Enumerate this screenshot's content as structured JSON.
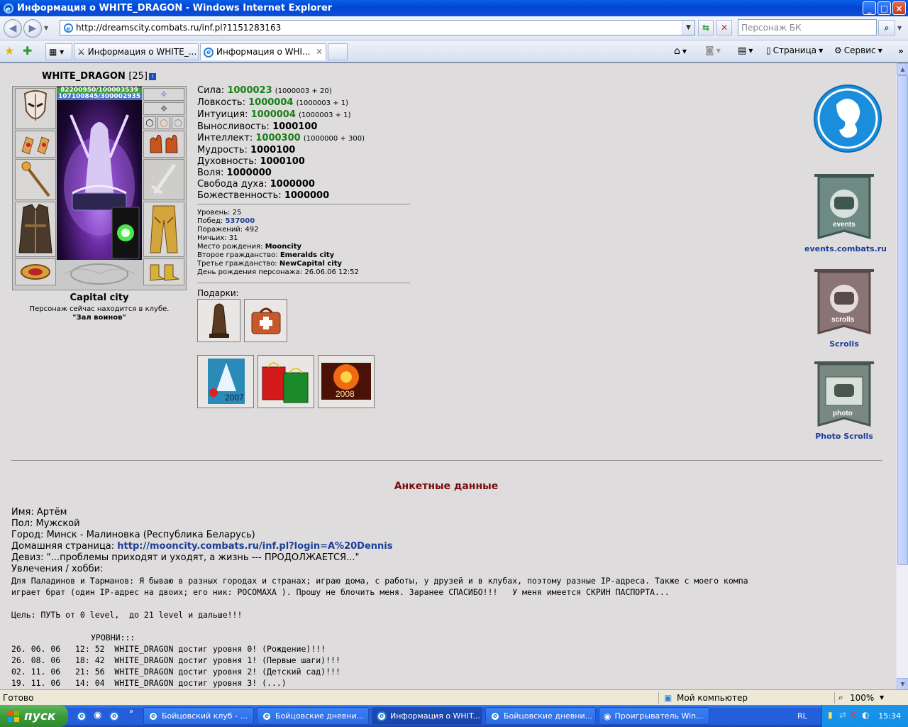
{
  "window": {
    "title": "Информация о WHITE_DRAGON - Windows Internet Explorer",
    "minimize": "_",
    "maximize": "□",
    "close": "×"
  },
  "address": {
    "url": "http://dreamscity.combats.ru/inf.pl?1151283163",
    "search_placeholder": "Персонаж БК"
  },
  "tabs": [
    {
      "label": "Информация о WHITE_..."
    },
    {
      "label": "Информация о WHI..."
    }
  ],
  "commands": {
    "page": "Страница",
    "service": "Сервис"
  },
  "character": {
    "name": "WHITE_DRAGON",
    "level": "[25]",
    "hp": "82200950/100003539",
    "mana": "107100845/300002935",
    "city": "Capital city",
    "location_line": "Персонаж сейчас находится в клубе.",
    "location_room": "\"Зал воинов\""
  },
  "stats": [
    {
      "label": "Сила:",
      "value": "1000023",
      "extra": "(1000003 + 20)",
      "color": "green"
    },
    {
      "label": "Ловкость:",
      "value": "1000004",
      "extra": "(1000003 + 1)",
      "color": "green"
    },
    {
      "label": "Интуиция:",
      "value": "1000004",
      "extra": "(1000003 + 1)",
      "color": "green"
    },
    {
      "label": "Выносливость:",
      "value": "1000100",
      "extra": "",
      "color": "black"
    },
    {
      "label": "Интеллект:",
      "value": "1000300",
      "extra": "(1000000 + 300)",
      "color": "green"
    },
    {
      "label": "Мудрость:",
      "value": "1000100",
      "extra": "",
      "color": "black"
    },
    {
      "label": "Духовность:",
      "value": "1000100",
      "extra": "",
      "color": "black"
    },
    {
      "label": "Воля:",
      "value": "1000000",
      "extra": "",
      "color": "black"
    },
    {
      "label": "Свобода духа:",
      "value": "1000000",
      "extra": "",
      "color": "black"
    },
    {
      "label": "Божественность:",
      "value": "1000000",
      "extra": "",
      "color": "black"
    }
  ],
  "info": [
    {
      "label": "Уровень:",
      "value": "25",
      "style": "plain"
    },
    {
      "label": "Побед:",
      "value": "537000",
      "style": "blue"
    },
    {
      "label": "Поражений:",
      "value": "492",
      "style": "plain"
    },
    {
      "label": "Ничьих:",
      "value": "31",
      "style": "plain"
    },
    {
      "label": "Место рождения:",
      "value": "Mooncity",
      "style": "bold"
    },
    {
      "label": "Второе гражданство:",
      "value": "Emeralds city",
      "style": "bold"
    },
    {
      "label": "Третье гражданство:",
      "value": "NewCapital city",
      "style": "bold"
    },
    {
      "label": "День рождения персонажа:",
      "value": "26.06.06 12:52",
      "style": "plain"
    }
  ],
  "gifts_label": "Подарки:",
  "sidebar": {
    "events_label": "events.combats.ru",
    "events_badge": "events",
    "scrolls_label": "Scrolls",
    "scrolls_badge": "scrolls",
    "photo_label": "Photo Scrolls",
    "photo_badge": "photo"
  },
  "gift_texts": {
    "year1": "2007",
    "year2": "2008"
  },
  "profile": {
    "heading": "Анкетные данные",
    "name": "Имя: Артём",
    "gender": "Пол: Мужской",
    "city": "Город: Минск - Малиновка (Республика Беларусь)",
    "homepage_label": "Домашняя страница:",
    "homepage_url": "http://mooncity.combats.ru/inf.pl?login=A%20Dennis",
    "motto": "Девиз: \"...проблемы приходят и уходят, а жизнь --- ПРОДОЛЖАЕТСЯ...\"",
    "hobby_label": "Увлечения / хобби:",
    "hobby_1": "Для Паладинов и Тарманов: Я бываю в разных городах и странах; играю дома, с работы, у друзей и в клубах, поэтому разные IP-адреса. Также с моего компа",
    "hobby_2": "играет брат (один IP-адрес на двоих; его ник: РОСОМАХА ). Прошу не блочить меня. Заранее СПАСИБО!!!   У меня имеется СКРИН ПАСПОРТА...",
    "goal": "Цель: ПУТЬ от 0 level,  до 21 level и дальше!!!",
    "levels_title": "УРОВНИ:::",
    "levels": [
      "26. 06. 06   12: 52  WHITE_DRAGON достиг уровня 0! (Рождение)!!!",
      "26. 08. 06   18: 42  WHITE_DRAGON достиг уровня 1! (Первые шаги)!!!",
      "02. 11. 06   21: 56  WHITE_DRAGON достиг уровня 2! (Детский сад)!!!",
      "19. 11. 06   14: 04  WHITE_DRAGON достиг уровня 3! (...)"
    ]
  },
  "statusbar": {
    "status": "Готово",
    "zone": "Мой компьютер",
    "zoom": "100%"
  },
  "taskbar": {
    "start": "пуск",
    "tasks": [
      {
        "label": "Бойцовский клуб - ..."
      },
      {
        "label": "Бойцовские дневни..."
      },
      {
        "label": "Информация о WHIT..."
      },
      {
        "label": "Бойцовские дневни..."
      },
      {
        "label": "Проигрыватель Win..."
      }
    ],
    "lang": "RL",
    "time": "15:34"
  }
}
